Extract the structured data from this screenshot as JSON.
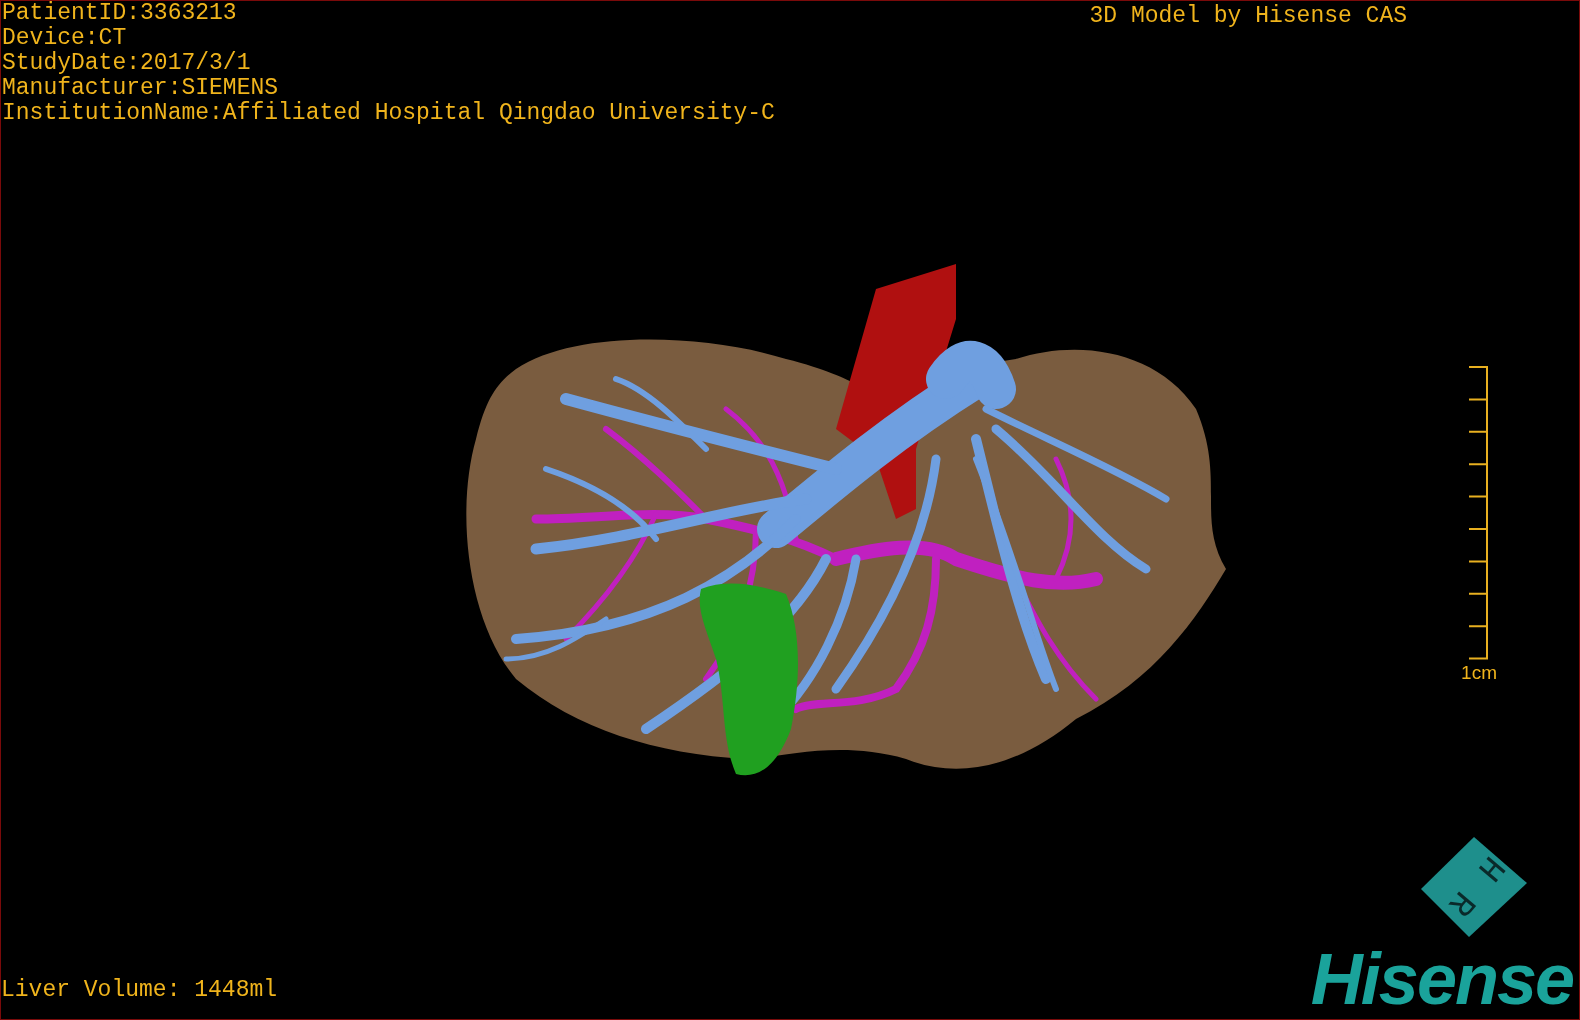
{
  "info_lines": [
    "PatientID:3363213",
    "Device:CT",
    "StudyDate:2017/3/1",
    "Manufacturer:SIEMENS",
    "InstitutionName:Affiliated Hospital Qingdao University-C"
  ],
  "title": "3D Model by Hisense CAS",
  "scale_bar": {
    "label": "1cm"
  },
  "orientation_cube": {
    "labels": [
      "H",
      "R"
    ]
  },
  "liver_volume": "Liver Volume: 1448ml",
  "logo": "Hisense"
}
